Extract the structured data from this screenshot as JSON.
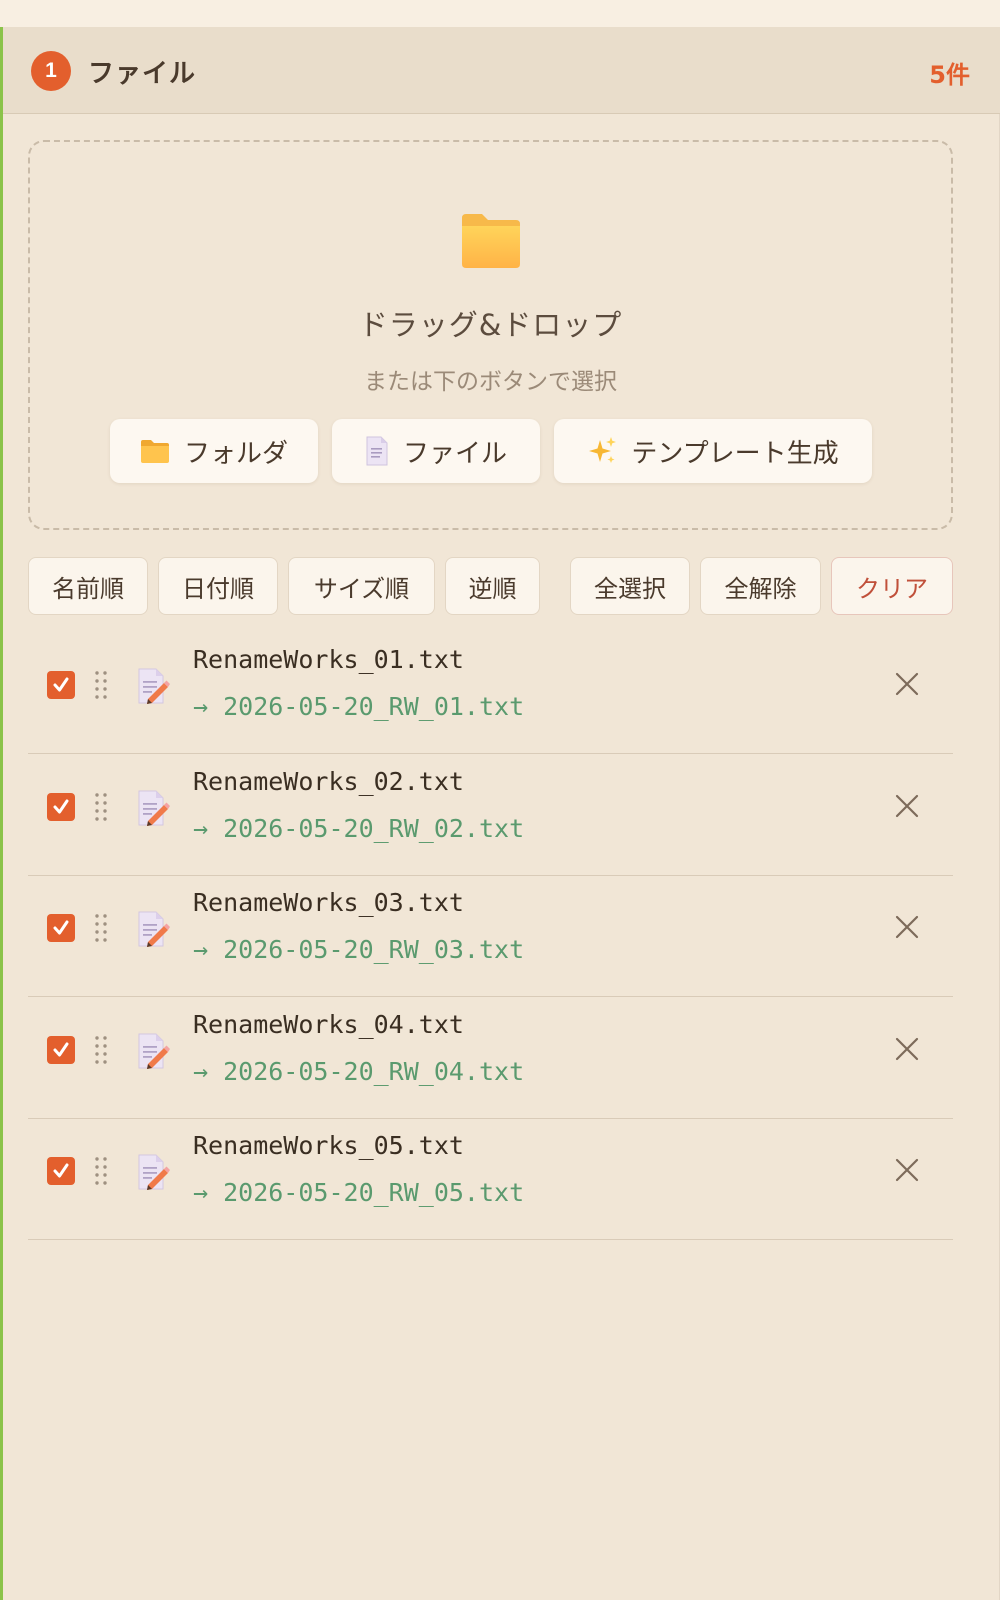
{
  "panel": {
    "step_number": "1",
    "title": "ファイル",
    "count": "5件"
  },
  "dropzone": {
    "title": "ドラッグ&ドロップ",
    "subtitle": "または下のボタンで選択",
    "icon": "folder-icon",
    "buttons": [
      {
        "label": "フォルダ",
        "icon": "folder-icon"
      },
      {
        "label": "ファイル",
        "icon": "document-icon"
      },
      {
        "label": "テンプレート生成",
        "icon": "sparkles-icon"
      }
    ]
  },
  "toolbar": {
    "sort_name": "名前順",
    "sort_date": "日付順",
    "sort_size": "サイズ順",
    "reverse": "逆順",
    "select_all": "全選択",
    "deselect_all": "全解除",
    "clear": "クリア"
  },
  "files": [
    {
      "name": "RenameWorks_01.txt",
      "new_name": "→ 2026-05-20_RW_01.txt",
      "checked": true
    },
    {
      "name": "RenameWorks_02.txt",
      "new_name": "→ 2026-05-20_RW_02.txt",
      "checked": true
    },
    {
      "name": "RenameWorks_03.txt",
      "new_name": "→ 2026-05-20_RW_03.txt",
      "checked": true
    },
    {
      "name": "RenameWorks_04.txt",
      "new_name": "→ 2026-05-20_RW_04.txt",
      "checked": true
    },
    {
      "name": "RenameWorks_05.txt",
      "new_name": "→ 2026-05-20_RW_05.txt",
      "checked": true
    }
  ],
  "colors": {
    "accent": "#e35f2d",
    "success_text": "#5a9a6e",
    "background": "#f1e6d6",
    "left_accent": "#8bc34a"
  }
}
